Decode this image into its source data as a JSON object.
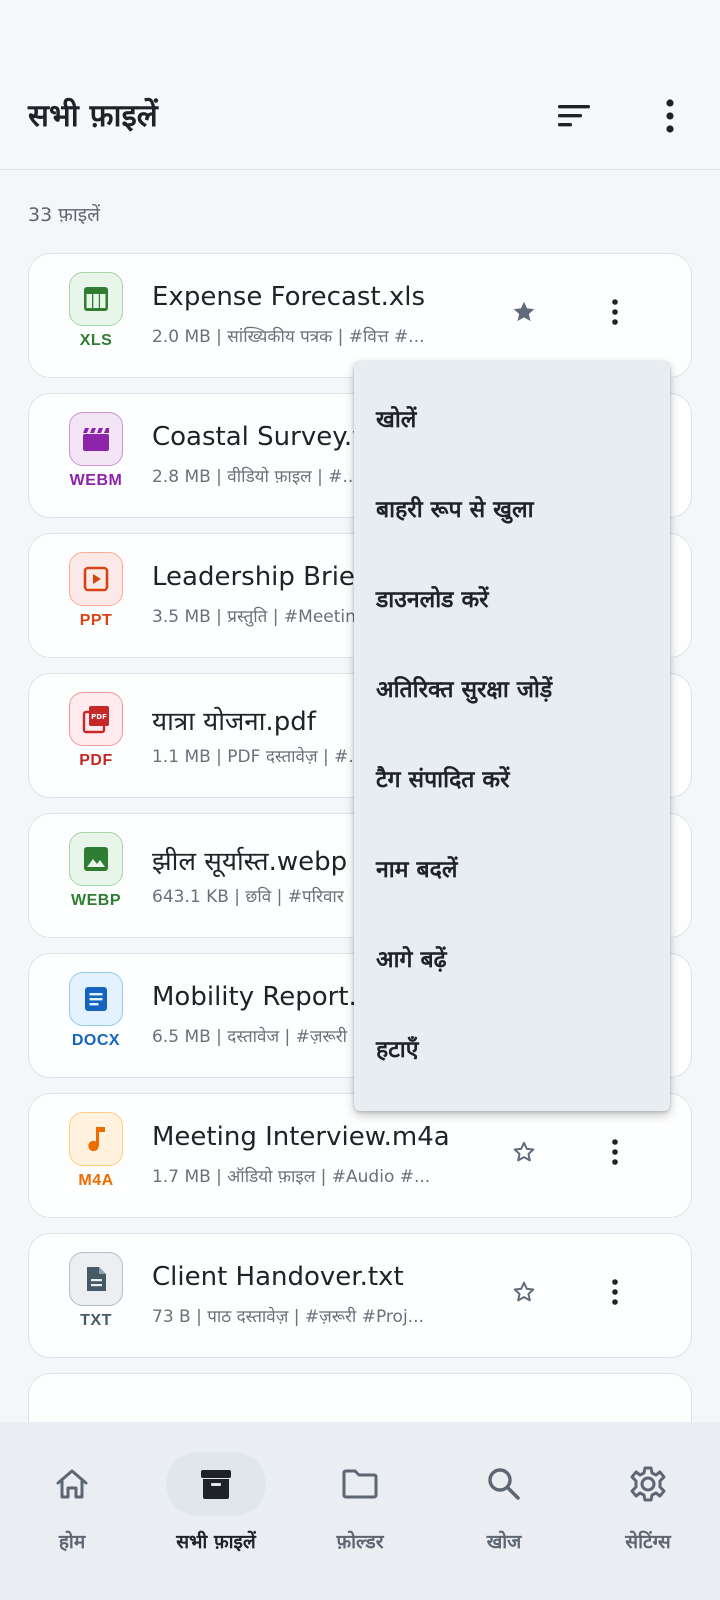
{
  "header": {
    "title": "सभी फ़ाइलें",
    "sort_icon": "sort-icon",
    "more_icon": "more-vertical-icon"
  },
  "file_count": "33 फ़ाइलें",
  "files": [
    {
      "name": "Expense Forecast.xls",
      "meta": "2.0 MB | सांख्यिकीय पत्रक | #वित्त  #...",
      "type": "XLS",
      "icon": "spreadsheet-icon",
      "color": "#2e7d32",
      "bg": "#e8f5e9",
      "starred": true
    },
    {
      "name": "Coastal Survey.webm",
      "meta": "2.8 MB | वीडियो फ़ाइल | #...",
      "type": "WEBM",
      "icon": "video-icon",
      "color": "#8e24aa",
      "bg": "#f3e5f5",
      "starred": false
    },
    {
      "name": "Leadership Brief.ppt",
      "meta": "3.5 MB | प्रस्तुति | #Meeting",
      "type": "PPT",
      "icon": "slideshow-icon",
      "color": "#d84315",
      "bg": "#fbe9e7",
      "starred": false
    },
    {
      "name": "यात्रा योजना.pdf",
      "meta": "1.1 MB | PDF दस्तावेज़ | #...",
      "type": "PDF",
      "icon": "pdf-icon",
      "color": "#c62828",
      "bg": "#ffebee",
      "starred": false
    },
    {
      "name": "झील सूर्यास्त.webp",
      "meta": "643.1 KB | छवि | #परिवार",
      "type": "WEBP",
      "icon": "image-icon",
      "color": "#2e7d32",
      "bg": "#e8f5e9",
      "starred": false
    },
    {
      "name": "Mobility Report.docx",
      "meta": "6.5 MB | दस्तावेज | #ज़रूरी",
      "type": "DOCX",
      "icon": "document-icon",
      "color": "#1565c0",
      "bg": "#e3f2fd",
      "starred": false
    },
    {
      "name": "Meeting Interview.m4a",
      "meta": "1.7 MB | ऑडियो फ़ाइल | #Audio  #...",
      "type": "M4A",
      "icon": "music-note-icon",
      "color": "#ef6c00",
      "bg": "#fff3e0",
      "starred": false
    },
    {
      "name": "Client Handover.txt",
      "meta": "73 B | पाठ दस्तावेज़ | #ज़रूरी  #Proj...",
      "type": "TXT",
      "icon": "text-file-icon",
      "color": "#455a64",
      "bg": "#eceff1",
      "starred": false
    }
  ],
  "context_menu": {
    "items": [
      "खोलें",
      "बाहरी रूप से खुला",
      "डाउनलोड करें",
      "अतिरिक्त सुरक्षा जोड़ें",
      "टैग संपादित करें",
      "नाम बदलें",
      "आगे बढ़ें",
      "हटाएँ"
    ]
  },
  "bottom_nav": [
    {
      "label": "होम",
      "icon": "home-icon",
      "active": false
    },
    {
      "label": "सभी फ़ाइलें",
      "icon": "archive-icon",
      "active": true
    },
    {
      "label": "फ़ोल्डर",
      "icon": "folder-icon",
      "active": false
    },
    {
      "label": "खोज",
      "icon": "search-icon",
      "active": false
    },
    {
      "label": "सेटिंग्स",
      "icon": "gear-icon",
      "active": false
    }
  ]
}
